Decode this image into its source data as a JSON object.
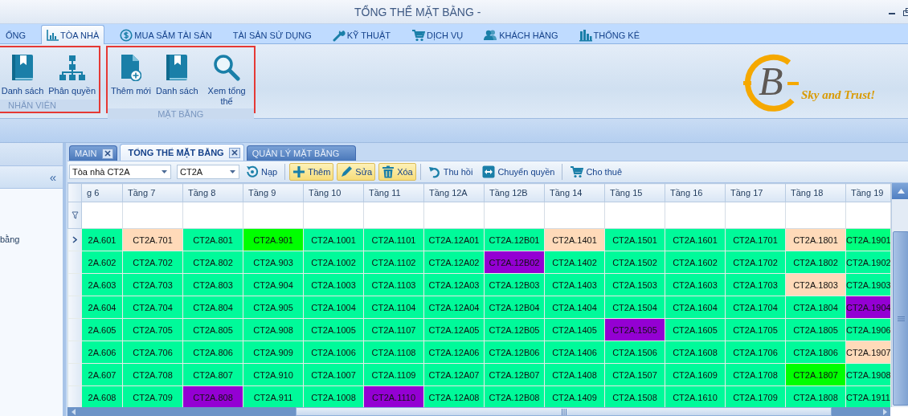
{
  "window": {
    "title": "TỔNG THỂ MẶT BẰNG -"
  },
  "ribbon_tabs": [
    {
      "label": "ỐNG",
      "selected": false
    },
    {
      "label": "TÒA NHÀ",
      "selected": true
    },
    {
      "label": "MUA SẮM TÀI SẢN",
      "selected": false
    },
    {
      "label": "TÀI SẢN SỬ DỤNG",
      "selected": false
    },
    {
      "label": "KỸ THUẬT",
      "selected": false
    },
    {
      "label": "DỊCH VỤ",
      "selected": false
    },
    {
      "label": "KHÁCH HÀNG",
      "selected": false
    },
    {
      "label": "THỐNG KÊ",
      "selected": false
    }
  ],
  "ribbon_groups": [
    {
      "label": "NHÂN VIÊN",
      "buttons": [
        {
          "label": "Danh sách"
        },
        {
          "label": "Phân quyền"
        }
      ]
    },
    {
      "label": "MẶT BẰNG",
      "buttons": [
        {
          "label": "Thêm mới"
        },
        {
          "label": "Danh sách"
        },
        {
          "label": "Xem tổng thể"
        }
      ]
    }
  ],
  "logo": {
    "letter": "B",
    "tagline": "Sky and Trust!"
  },
  "side_panel": {
    "collapse": "«",
    "items": [
      {
        "label": "bằng"
      }
    ]
  },
  "document_tabs": [
    {
      "label": "MAIN",
      "selected": false,
      "closable": true
    },
    {
      "label": "TỔNG THỂ MẶT BẰNG",
      "selected": true,
      "closable": true
    },
    {
      "label": "QUẢN LÝ MẶT BẰNG",
      "selected": false,
      "closable": false
    }
  ],
  "toolbar": {
    "selectors": [
      {
        "value": "Tòa nhà CT2A"
      },
      {
        "value": "CT2A"
      }
    ],
    "button_groups": [
      {
        "buttons": [
          {
            "label": "Nạp",
            "highlighted": false
          }
        ]
      },
      {
        "buttons": [
          {
            "label": "Thêm",
            "highlighted": true
          },
          {
            "label": "Sửa",
            "highlighted": true
          },
          {
            "label": "Xóa",
            "highlighted": true
          }
        ]
      },
      {
        "buttons": [
          {
            "label": "Thu hồi",
            "highlighted": false
          },
          {
            "label": "Chuyển quyền",
            "highlighted": false
          }
        ]
      },
      {
        "buttons": [
          {
            "label": "Cho thuê",
            "highlighted": false
          }
        ]
      }
    ]
  },
  "grid": {
    "columns": [
      "g 6",
      "Tầng 7",
      "Tầng 8",
      "Tầng 9",
      "Tầng 10",
      "Tầng 11",
      "Tầng 12A",
      "Tầng 12B",
      "Tầng 14",
      "Tầng 15",
      "Tầng 16",
      "Tầng 17",
      "Tầng 18",
      "Tầng 19"
    ],
    "rows": [
      {
        "selected": true,
        "cells": [
          {
            "text": "2A.601",
            "color": "#00fa9a"
          },
          {
            "text": "CT2A.701",
            "color": "#ffdab9"
          },
          {
            "text": "CT2A.801",
            "color": "#00fa9a"
          },
          {
            "text": "CT2A.901",
            "color": "#00ff00"
          },
          {
            "text": "CT2A.1001",
            "color": "#00fa9a"
          },
          {
            "text": "CT2A.1101",
            "color": "#00fa9a"
          },
          {
            "text": "CT2A.12A01",
            "color": "#00fa9a"
          },
          {
            "text": "CT2A.12B01",
            "color": "#00fa9a"
          },
          {
            "text": "CT2A.1401",
            "color": "#ffdab9"
          },
          {
            "text": "CT2A.1501",
            "color": "#00fa9a"
          },
          {
            "text": "CT2A.1601",
            "color": "#00fa9a"
          },
          {
            "text": "CT2A.1701",
            "color": "#00fa9a"
          },
          {
            "text": "CT2A.1801",
            "color": "#ffdab9"
          },
          {
            "text": "CT2A.1901",
            "color": "#00ff7f"
          }
        ]
      },
      {
        "selected": false,
        "cells": [
          {
            "text": "2A.602",
            "color": "#00fa9a"
          },
          {
            "text": "CT2A.702",
            "color": "#00fa9a"
          },
          {
            "text": "CT2A.802",
            "color": "#00fa9a"
          },
          {
            "text": "CT2A.903",
            "color": "#00fa9a"
          },
          {
            "text": "CT2A.1002",
            "color": "#00fa9a"
          },
          {
            "text": "CT2A.1102",
            "color": "#00fa9a"
          },
          {
            "text": "CT2A.12A02",
            "color": "#00fa9a"
          },
          {
            "text": "CT2A.12B02",
            "color": "#9400d3"
          },
          {
            "text": "CT2A.1402",
            "color": "#00fa9a"
          },
          {
            "text": "CT2A.1502",
            "color": "#00fa9a"
          },
          {
            "text": "CT2A.1602",
            "color": "#00fa9a"
          },
          {
            "text": "CT2A.1702",
            "color": "#00fa9a"
          },
          {
            "text": "CT2A.1802",
            "color": "#00fa9a"
          },
          {
            "text": "CT2A.1902",
            "color": "#00fa9a"
          }
        ]
      },
      {
        "selected": false,
        "cells": [
          {
            "text": "2A.603",
            "color": "#00fa9a"
          },
          {
            "text": "CT2A.703",
            "color": "#00fa9a"
          },
          {
            "text": "CT2A.803",
            "color": "#00fa9a"
          },
          {
            "text": "CT2A.904",
            "color": "#00fa9a"
          },
          {
            "text": "CT2A.1003",
            "color": "#00fa9a"
          },
          {
            "text": "CT2A.1103",
            "color": "#00fa9a"
          },
          {
            "text": "CT2A.12A03",
            "color": "#00fa9a"
          },
          {
            "text": "CT2A.12B03",
            "color": "#00fa9a"
          },
          {
            "text": "CT2A.1403",
            "color": "#00fa9a"
          },
          {
            "text": "CT2A.1503",
            "color": "#00fa9a"
          },
          {
            "text": "CT2A.1603",
            "color": "#00fa9a"
          },
          {
            "text": "CT2A.1703",
            "color": "#00fa9a"
          },
          {
            "text": "CT2A.1803",
            "color": "#ffdab9"
          },
          {
            "text": "CT2A.1903",
            "color": "#00fa9a"
          }
        ]
      },
      {
        "selected": false,
        "cells": [
          {
            "text": "2A.604",
            "color": "#00fa9a"
          },
          {
            "text": "CT2A.704",
            "color": "#00fa9a"
          },
          {
            "text": "CT2A.804",
            "color": "#00fa9a"
          },
          {
            "text": "CT2A.905",
            "color": "#00fa9a"
          },
          {
            "text": "CT2A.1004",
            "color": "#00fa9a"
          },
          {
            "text": "CT2A.1104",
            "color": "#00fa9a"
          },
          {
            "text": "CT2A.12A04",
            "color": "#00fa9a"
          },
          {
            "text": "CT2A.12B04",
            "color": "#00fa9a"
          },
          {
            "text": "CT2A.1404",
            "color": "#00fa9a"
          },
          {
            "text": "CT2A.1504",
            "color": "#00fa9a"
          },
          {
            "text": "CT2A.1604",
            "color": "#00fa9a"
          },
          {
            "text": "CT2A.1704",
            "color": "#00fa9a"
          },
          {
            "text": "CT2A.1804",
            "color": "#00fa9a"
          },
          {
            "text": "CT2A.1904",
            "color": "#9400d3"
          }
        ]
      },
      {
        "selected": false,
        "cells": [
          {
            "text": "2A.605",
            "color": "#00fa9a"
          },
          {
            "text": "CT2A.705",
            "color": "#00fa9a"
          },
          {
            "text": "CT2A.805",
            "color": "#00fa9a"
          },
          {
            "text": "CT2A.908",
            "color": "#00fa9a"
          },
          {
            "text": "CT2A.1005",
            "color": "#00fa9a"
          },
          {
            "text": "CT2A.1107",
            "color": "#00fa9a"
          },
          {
            "text": "CT2A.12A05",
            "color": "#00fa9a"
          },
          {
            "text": "CT2A.12B05",
            "color": "#00fa9a"
          },
          {
            "text": "CT2A.1405",
            "color": "#00fa9a"
          },
          {
            "text": "CT2A.1505",
            "color": "#9400d3"
          },
          {
            "text": "CT2A.1605",
            "color": "#00fa9a"
          },
          {
            "text": "CT2A.1705",
            "color": "#00fa9a"
          },
          {
            "text": "CT2A.1805",
            "color": "#00fa9a"
          },
          {
            "text": "CT2A.1906",
            "color": "#00fa9a"
          }
        ]
      },
      {
        "selected": false,
        "cells": [
          {
            "text": "2A.606",
            "color": "#00fa9a"
          },
          {
            "text": "CT2A.706",
            "color": "#00fa9a"
          },
          {
            "text": "CT2A.806",
            "color": "#00fa9a"
          },
          {
            "text": "CT2A.909",
            "color": "#00fa9a"
          },
          {
            "text": "CT2A.1006",
            "color": "#00fa9a"
          },
          {
            "text": "CT2A.1108",
            "color": "#00fa9a"
          },
          {
            "text": "CT2A.12A06",
            "color": "#00fa9a"
          },
          {
            "text": "CT2A.12B06",
            "color": "#00fa9a"
          },
          {
            "text": "CT2A.1406",
            "color": "#00fa9a"
          },
          {
            "text": "CT2A.1506",
            "color": "#00fa9a"
          },
          {
            "text": "CT2A.1608",
            "color": "#00fa9a"
          },
          {
            "text": "CT2A.1706",
            "color": "#00fa9a"
          },
          {
            "text": "CT2A.1806",
            "color": "#00fa9a"
          },
          {
            "text": "CT2A.1907",
            "color": "#ffdab9"
          }
        ]
      },
      {
        "selected": false,
        "cells": [
          {
            "text": "2A.607",
            "color": "#00fa9a"
          },
          {
            "text": "CT2A.708",
            "color": "#00fa9a"
          },
          {
            "text": "CT2A.807",
            "color": "#00fa9a"
          },
          {
            "text": "CT2A.910",
            "color": "#00fa9a"
          },
          {
            "text": "CT2A.1007",
            "color": "#00fa9a"
          },
          {
            "text": "CT2A.1109",
            "color": "#00fa9a"
          },
          {
            "text": "CT2A.12A07",
            "color": "#00fa9a"
          },
          {
            "text": "CT2A.12B07",
            "color": "#00fa9a"
          },
          {
            "text": "CT2A.1408",
            "color": "#00fa9a"
          },
          {
            "text": "CT2A.1507",
            "color": "#00fa9a"
          },
          {
            "text": "CT2A.1609",
            "color": "#00fa9a"
          },
          {
            "text": "CT2A.1708",
            "color": "#00fa9a"
          },
          {
            "text": "CT2A.1807",
            "color": "#00ff00"
          },
          {
            "text": "CT2A.1908",
            "color": "#00fa9a"
          }
        ]
      },
      {
        "selected": false,
        "cells": [
          {
            "text": "2A.608",
            "color": "#00fa9a"
          },
          {
            "text": "CT2A.709",
            "color": "#00fa9a"
          },
          {
            "text": "CT2A.808",
            "color": "#9400d3"
          },
          {
            "text": "CT2A.911",
            "color": "#00fa9a"
          },
          {
            "text": "CT2A.1008",
            "color": "#00fa9a"
          },
          {
            "text": "CT2A.1110",
            "color": "#9400d3"
          },
          {
            "text": "CT2A.12A08",
            "color": "#00fa9a"
          },
          {
            "text": "CT2A.12B08",
            "color": "#00fa9a"
          },
          {
            "text": "CT2A.1409",
            "color": "#00fa9a"
          },
          {
            "text": "CT2A.1508",
            "color": "#00fa9a"
          },
          {
            "text": "CT2A.1610",
            "color": "#00fa9a"
          },
          {
            "text": "CT2A.1709",
            "color": "#00fa9a"
          },
          {
            "text": "CT2A.1808",
            "color": "#00fa9a"
          },
          {
            "text": "CT2A.1911",
            "color": "#00fa9a"
          }
        ]
      }
    ]
  }
}
